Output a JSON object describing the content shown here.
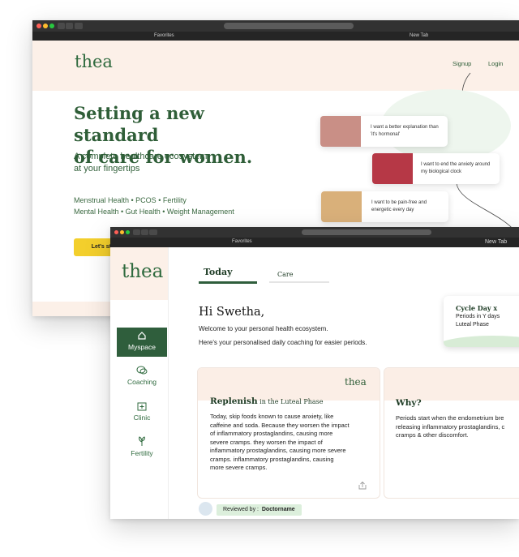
{
  "back_window": {
    "tabs": [
      "Favorites",
      "New Tab"
    ],
    "brand": "thea",
    "nav": {
      "signup": "Signup",
      "login": "Login"
    },
    "hero": {
      "title_line1": "Setting a new standard",
      "title_line2": "of care for women.",
      "subtitle_line1": "A complete healthcare ecosystem",
      "subtitle_line2": "at your fingertips",
      "tags_line1": "Menstrual Health  •  PCOS  •  Fertility",
      "tags_line2": "Mental Health  •  Gut Health  •  Weight Management",
      "cta": "Let's st"
    },
    "quotes": [
      {
        "line1": "I want a better explanation than",
        "line2": "'it's hormonal'"
      },
      {
        "line1": "I want to end the anxiety around",
        "line2": "my biological clock"
      },
      {
        "line1": "I want to be pain-free and",
        "line2": "energetic every day"
      }
    ]
  },
  "front_window": {
    "tabs": [
      "Favorites",
      "New Tab"
    ],
    "brand": "thea",
    "sidebar": [
      {
        "label": "Myspace",
        "icon": "home-icon",
        "active": true
      },
      {
        "label": "Coaching",
        "icon": "chat-icon",
        "active": false
      },
      {
        "label": "Clinic",
        "icon": "clinic-icon",
        "active": false
      },
      {
        "label": "Fertility",
        "icon": "fertility-icon",
        "active": false
      }
    ],
    "tabs_main": {
      "today": "Today",
      "care": "Care"
    },
    "greeting": "Hi Swetha,",
    "welcome": "Welcome to your personal health ecosystem.",
    "coaching_note": "Here's your personalised daily coaching for easier periods.",
    "cycle": {
      "title": "Cycle Day x",
      "line1": "Periods in Y days",
      "line2": "Luteal Phase"
    },
    "card1": {
      "brand": "thea",
      "title_main": "Replenish",
      "title_rest": " in the Luteal Phase",
      "body": [
        "Today, skip foods known to cause anxiety, like",
        "caffeine and soda. Because they worsen the impact",
        "of inflammatory prostaglandins, causing more",
        "severe cramps. they worsen the impact of",
        "inflammatory prostaglandins, causing more severe",
        "cramps. inflammatory prostaglandins, causing",
        "more severe cramps."
      ]
    },
    "card2": {
      "title": "Why?",
      "body": [
        "Periods start when the endometrium bre",
        "releasing inflammatory prostaglandins, c",
        "cramps & other discomfort."
      ]
    },
    "reviewed_prefix": "Reviewed by :",
    "reviewer": "Doctorname"
  },
  "colors": {
    "brand_green": "#2f5e3c",
    "peach": "#fcf0e8",
    "cta_yellow": "#f3cf2c",
    "tag_green": "#dcefdc"
  }
}
